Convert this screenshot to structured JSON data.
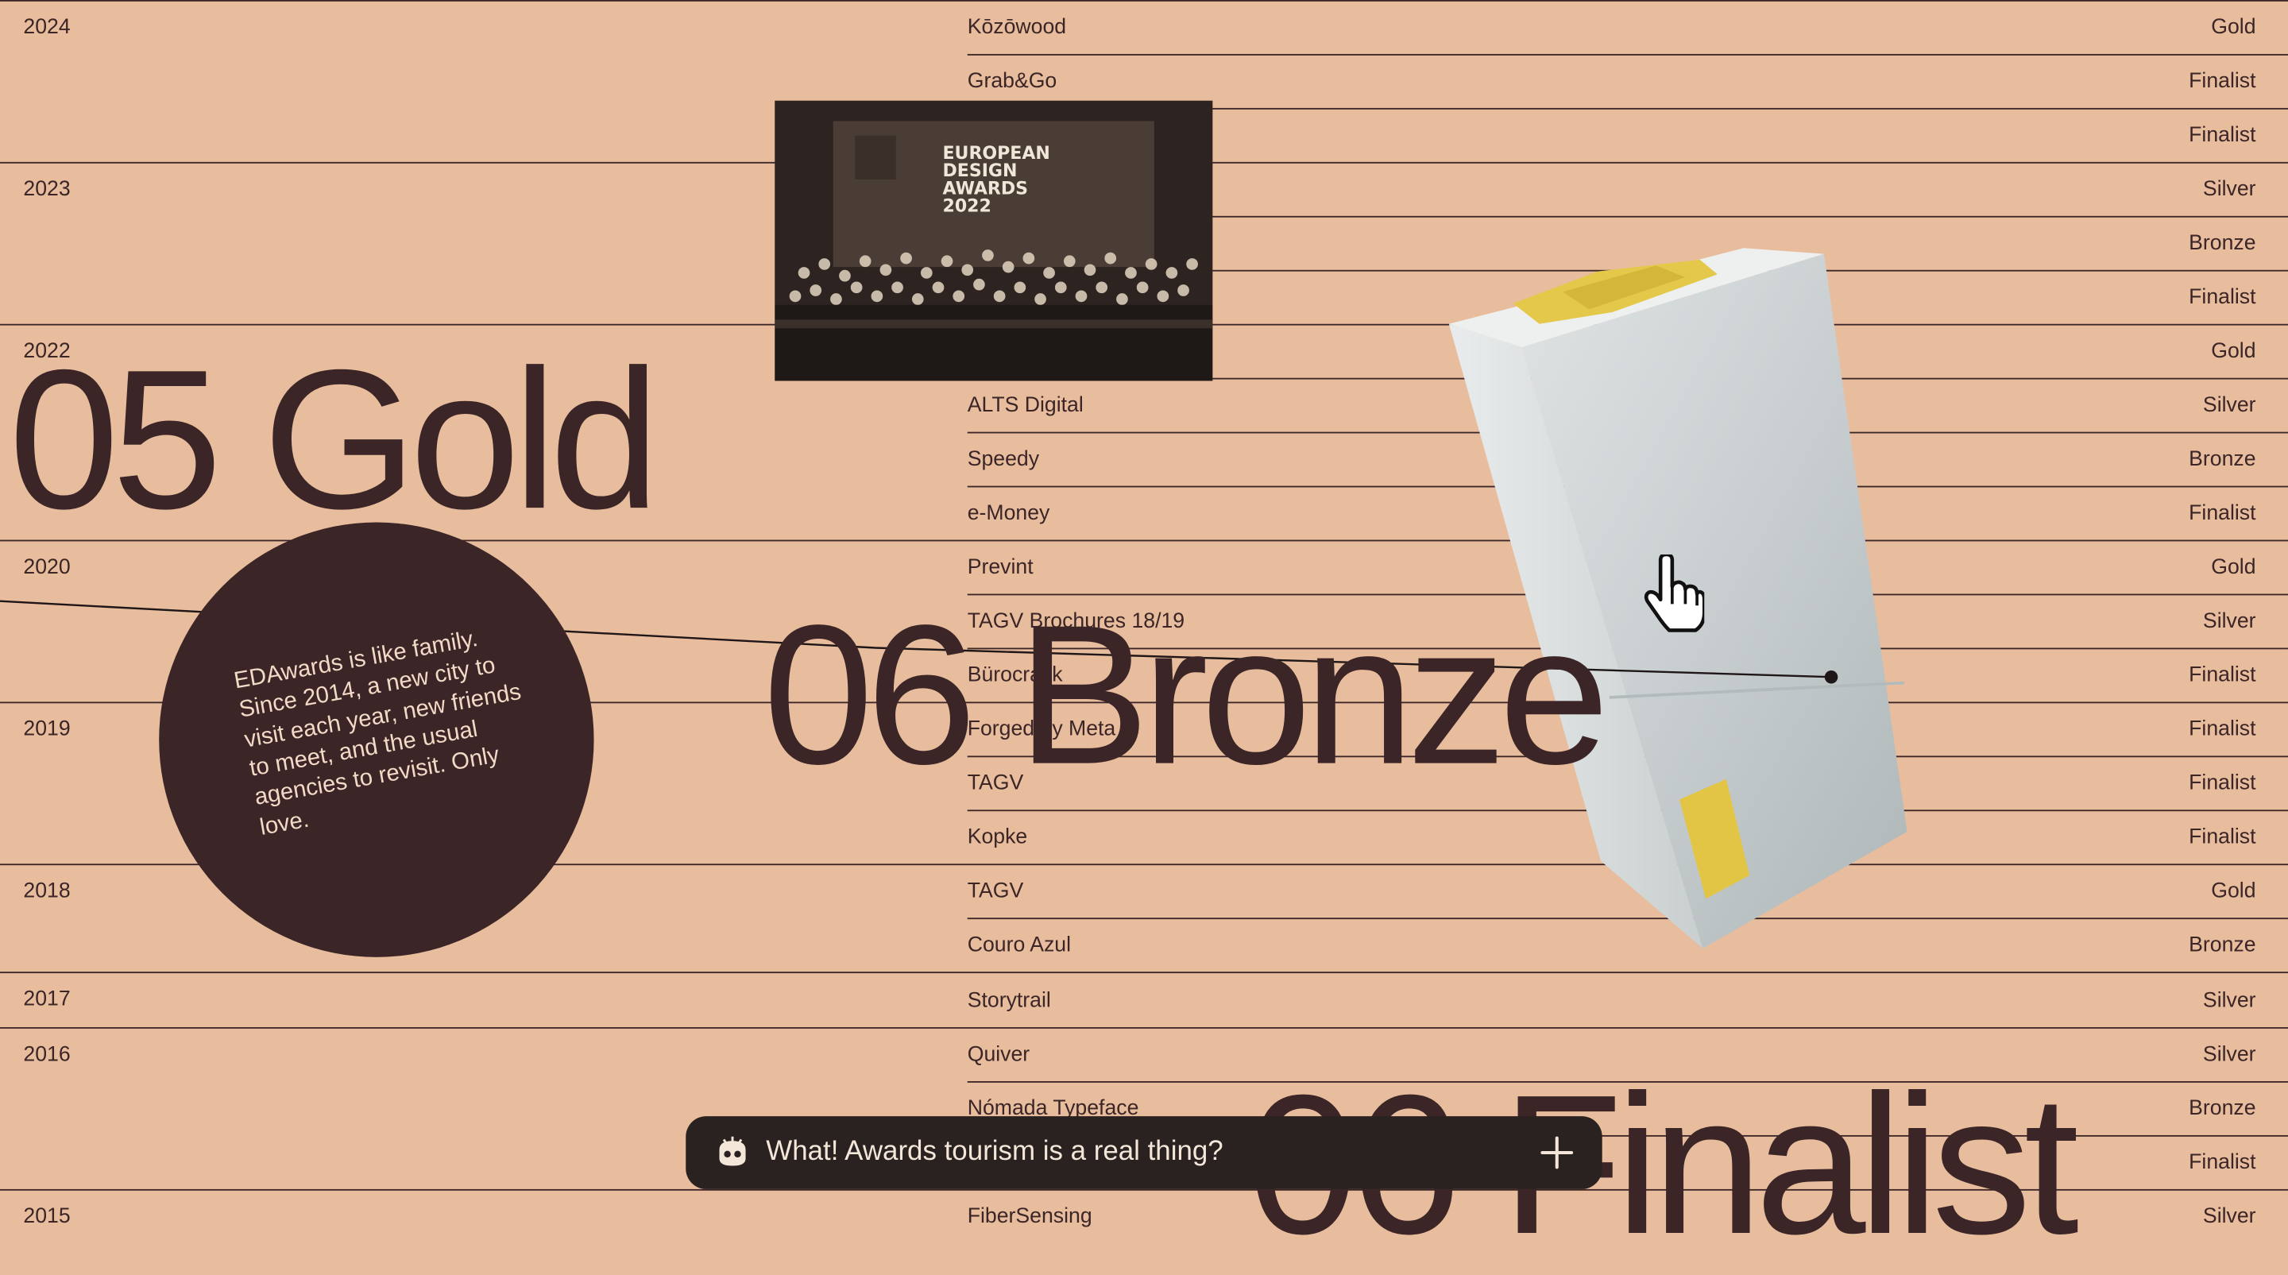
{
  "years": [
    "2024",
    "2023",
    "2022",
    "2020",
    "2019",
    "2018",
    "2017",
    "2016",
    "2015"
  ],
  "entries": [
    {
      "project": "Kōzōwood",
      "award": "Gold"
    },
    {
      "project": "Grab&Go",
      "award": "Finalist"
    },
    {
      "project": "",
      "award": "Finalist"
    },
    {
      "project": "",
      "award": "Silver"
    },
    {
      "project": "",
      "award": "Bronze"
    },
    {
      "project": "",
      "award": "Finalist"
    },
    {
      "project": "",
      "award": "Gold"
    },
    {
      "project": "ALTS Digital",
      "award": "Silver"
    },
    {
      "project": "Speedy",
      "award": "Bronze"
    },
    {
      "project": "e-Money",
      "award": "Finalist"
    },
    {
      "project": "Prevint",
      "award": "Gold"
    },
    {
      "project": "TAGV Brochures 18/19",
      "award": "Silver"
    },
    {
      "project": "Bürocratik",
      "award": "Finalist"
    },
    {
      "project": "Forged by Meta",
      "award": "Finalist"
    },
    {
      "project": "TAGV",
      "award": "Finalist"
    },
    {
      "project": "Kopke",
      "award": "Finalist"
    },
    {
      "project": "TAGV",
      "award": "Gold"
    },
    {
      "project": "Couro Azul",
      "award": "Bronze"
    },
    {
      "project": "Storytrail",
      "award": "Silver"
    },
    {
      "project": "Quiver",
      "award": "Silver"
    },
    {
      "project": "Nómada Typeface",
      "award": "Bronze"
    },
    {
      "project": "",
      "award": "Finalist"
    },
    {
      "project": "FiberSensing",
      "award": "Silver"
    }
  ],
  "stats": {
    "gold": "05 Gold",
    "bronze": "06 Bronze",
    "finalist": "06 Finalist"
  },
  "photo": {
    "sign_line1": "EUROPEAN",
    "sign_line2": "DESIGN",
    "sign_line3": "AWARDS",
    "sign_line4": "2022"
  },
  "circle_text": "EDAwards is like family. Since 2014, a new city to visit each year, new friends to meet, and the usual agencies to revisit. Only love.",
  "chat_prompt": {
    "text": "What! Awards tourism is a real thing?",
    "icon": "mascot-face-icon",
    "action_icon": "plus-icon"
  },
  "colors": {
    "background": "#E8BD9D",
    "ink": "#3B2527",
    "pill": "#2A2220",
    "trophy_gold": "#E4C84A"
  }
}
